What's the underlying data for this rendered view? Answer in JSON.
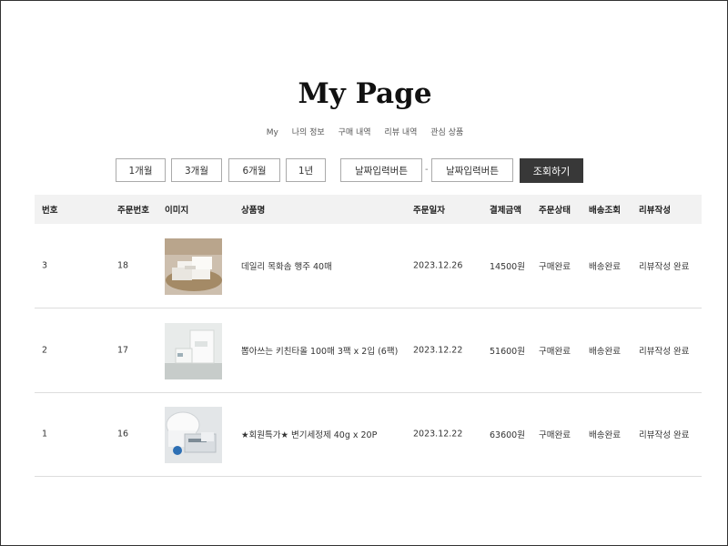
{
  "page": {
    "title": "My Page"
  },
  "subnav": [
    "My",
    "나의 정보",
    "구매 내역",
    "리뷰 내역",
    "관심 상품"
  ],
  "period_buttons": [
    "1개월",
    "3개월",
    "6개월",
    "1년"
  ],
  "date_inputs": {
    "start": "날짜입력버튼",
    "separator": "-",
    "end": "날짜입력버튼"
  },
  "search_button": "조회하기",
  "table": {
    "headers": [
      "번호",
      "주문번호",
      "이미지",
      "상품명",
      "주문일자",
      "결제금액",
      "주문상태",
      "배송조회",
      "리뷰작성"
    ],
    "rows": [
      {
        "no": "3",
        "order": "18",
        "product": "데일리 목화솜 행주 40매",
        "date": "2023.12.26",
        "amount": "14500원",
        "status": "구매완료",
        "shipping": "배송완료",
        "review": "리뷰작성 완료",
        "image_icon": "towel-product-image"
      },
      {
        "no": "2",
        "order": "17",
        "product": "뽑아쓰는 키친타올 100매 3팩 x 2입 (6팩)",
        "date": "2023.12.22",
        "amount": "51600원",
        "status": "구매완료",
        "shipping": "배송완료",
        "review": "리뷰작성 완료",
        "image_icon": "kitchen-towel-product-image"
      },
      {
        "no": "1",
        "order": "16",
        "product": "★회원특가★ 변기세정제 40g x 20P",
        "date": "2023.12.22",
        "amount": "63600원",
        "status": "구매완료",
        "shipping": "배송완료",
        "review": "리뷰작성 완료",
        "image_icon": "toilet-cleaner-product-image"
      }
    ]
  }
}
